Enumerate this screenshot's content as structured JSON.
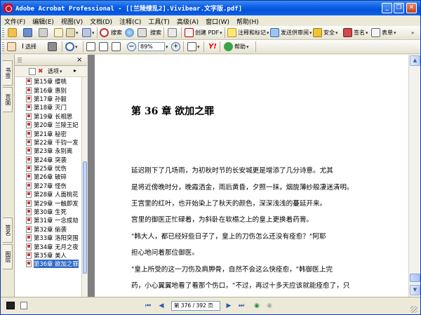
{
  "window": {
    "title": "Adobe Acrobat Professional - [[兰陵缭乱2].Vivibear.文字版.pdf]",
    "controls": {
      "minimize": "_",
      "restore": "❐",
      "close": "✕"
    }
  },
  "menu": [
    "文件(F)",
    "编辑(E)",
    "视图(V)",
    "文档(D)",
    "注释(C)",
    "工具(T)",
    "高级(A)",
    "窗口(W)",
    "帮助(H)"
  ],
  "toolbar1": {
    "find_label": "搜索",
    "create_pdf": "创建 PDF",
    "comment_markup": "注释和标记",
    "send_review": "发送供审阅",
    "secure": "安全",
    "sign": "签名",
    "forms": "表单",
    "icons": [
      "open-folder-icon",
      "save-icon",
      "print-icon",
      "email-icon",
      "search-icon",
      "scissors-icon"
    ]
  },
  "toolbar2": {
    "select_label": "选择",
    "zoom_value": "89%",
    "help_label": "帮助"
  },
  "nav_tabs": {
    "bookmarks": "书签",
    "pages": "页面",
    "signatures": "签名",
    "layers": "图层"
  },
  "bookmarks_panel": {
    "options_label": "选项",
    "close": "×",
    "items": [
      "第15章 缨桃",
      "第16章 惠别",
      "第17章 孙毅",
      "第18章 灭门",
      "第19章 长相思",
      "第20章 兰陵王妃",
      "第21章 秘密",
      "第22章 千钧一发",
      "第23章 永别离",
      "第24章 突袭",
      "第25章 忧伤",
      "第26章 破碎",
      "第27章 怪伤",
      "第28章 人面桃花",
      "第29章 一触即发",
      "第30章 生死",
      "第31章 一念成劫",
      "第32章 偷袭",
      "第33章 洛阳突围",
      "第34章 无月之夜",
      "第35章 美人",
      "第36章 欲加之罪"
    ],
    "selected_index": 21
  },
  "document": {
    "chapter_title": "第 36 章  欲加之罪",
    "paragraphs": [
      "    延迟刚下了几场雨，为初秋时节的长安城更是增添了几分诗意。尤其",
      "是将近傍晚时分，晚霞洒金，雨后黄昏，夕照一抹，烟旎薄纱般凄迷清明。",
      "    王宫里的红叶，也开始染上了秋天的颜色，深深浅浅的蔓延开来。",
      "    宫里的御医正忙碌着，为斜卧在软榻之上的皇上更换着药膏。",
      "    \"韩大人，都已经好些日子了，皇上的刀伤怎么还没有痊愈？\"阿耶",
      "担心地问着那位御医。",
      "    \"皇上所受的这一刀伤及肩胛骨，自然不会这么快痊愈，\"韩御医上完",
      "药，小心翼翼地看了看那个伤口，\"不过，再过十多天应该就能痊愈了，只"
    ]
  },
  "status": {
    "page_display": "第 376 / 392 页",
    "current_page": 376,
    "total_pages": 392
  }
}
